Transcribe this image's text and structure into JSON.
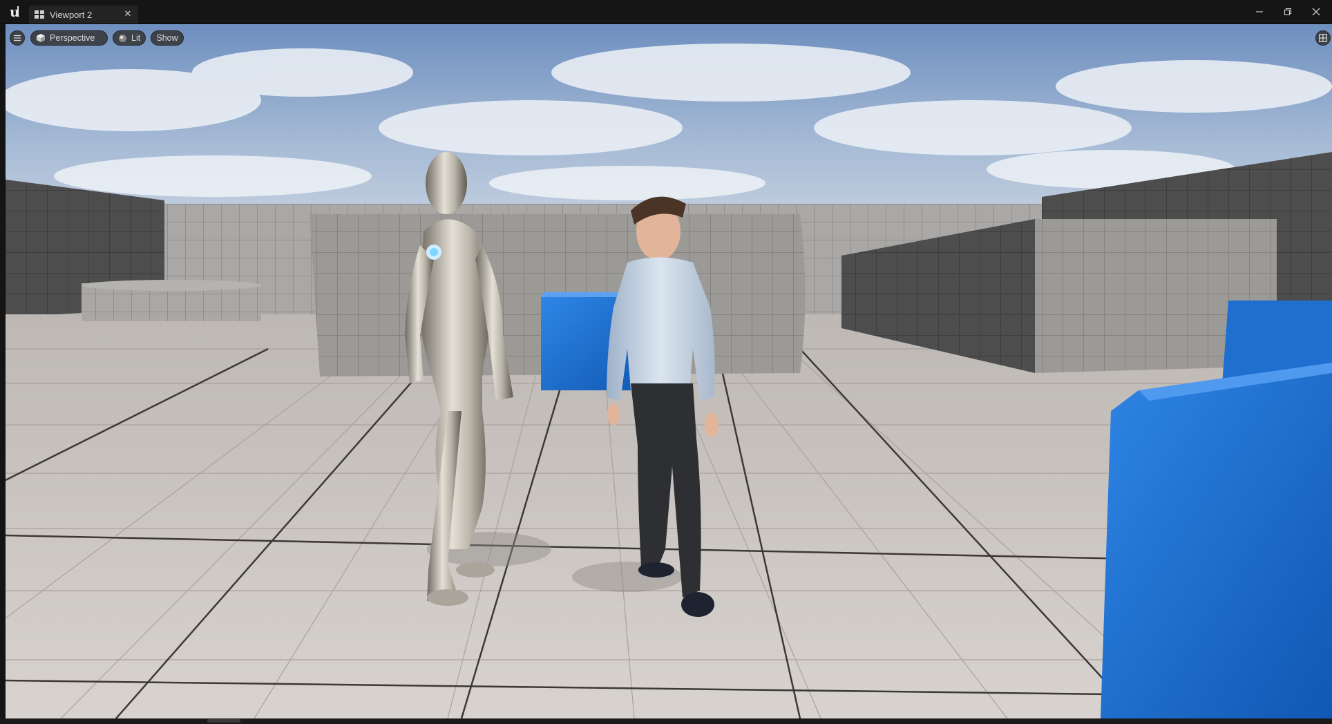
{
  "window": {
    "tab_label": "Viewport 2",
    "tab_close_glyph": "✕"
  },
  "toolbar": {
    "menu_icon": "hamburger-menu-icon",
    "perspective_label": "Perspective",
    "lit_label": "Lit",
    "show_label": "Show",
    "layout_icon": "viewport-layout-icon"
  },
  "scene": {
    "sky_color": "#9db3cf",
    "floor_color": "#cfcac6",
    "wall_color": "#a9a8a6",
    "dark_wall_color": "#4e4e4e",
    "cube_color": "#1e6fd0",
    "characters": [
      "silver-android-mannequin",
      "cartoon-man-blue-shirt"
    ]
  },
  "colors": {
    "titlebar_bg": "#151515",
    "tab_bg": "#242424",
    "button_bg": "#343434",
    "text": "#dcdcdc"
  }
}
